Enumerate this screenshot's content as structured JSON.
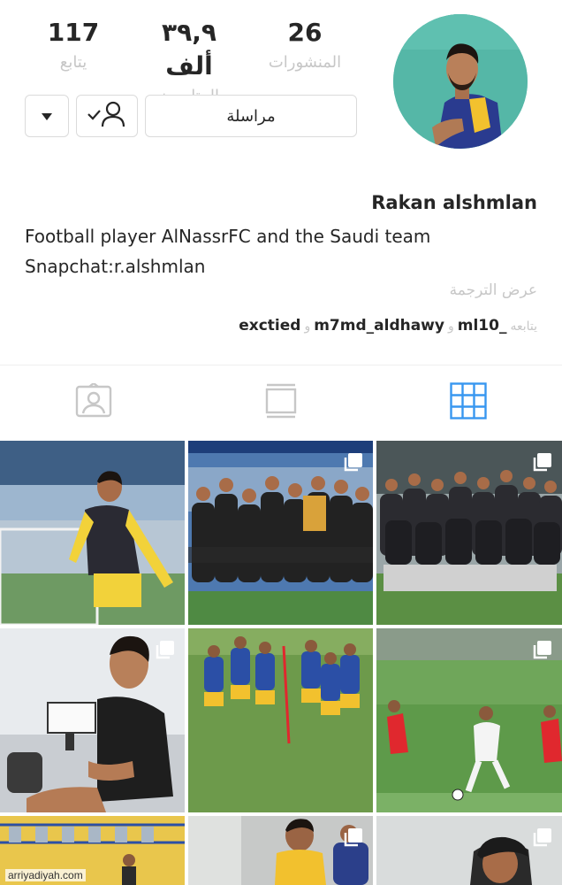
{
  "stats": {
    "following": {
      "value": "117",
      "label": "يتابع"
    },
    "followers": {
      "value": "٣٩,٩ ألف",
      "label": "المتابعون"
    },
    "posts": {
      "value": "26",
      "label": "المنشورات"
    }
  },
  "actions": {
    "message_label": "مراسلة"
  },
  "profile": {
    "name": "Rakan alshmlan",
    "bio_line1": "Football player AlNassrFC and the Saudi team",
    "bio_line2": "Snapchat:r.alshmlan",
    "translate_label": "عرض الترجمة"
  },
  "followed_by": {
    "prefix": "يتابعه",
    "users": [
      "_ml10",
      "m7md_aldhawy",
      "exctied"
    ],
    "separator": "و"
  },
  "tabs": [
    "tagged",
    "igtv",
    "grid"
  ],
  "colors": {
    "accent": "#3897f0",
    "muted": "#c7c7c7",
    "border": "#dbdbdb"
  },
  "watermark": "arriyadiyah.com"
}
